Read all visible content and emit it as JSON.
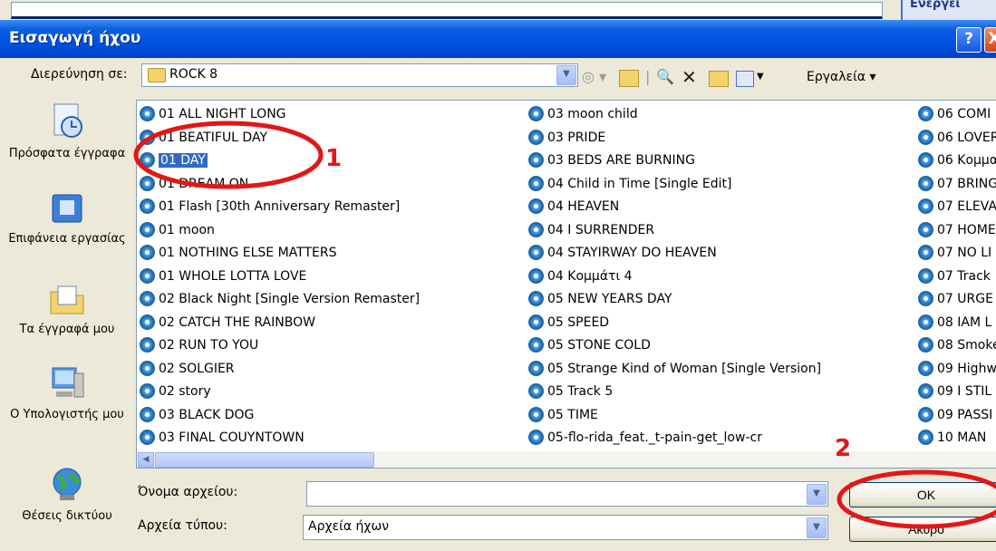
{
  "background": {
    "right_fragment_text": "Ενεργεί"
  },
  "dialog": {
    "title": "Εισαγωγή ήχου",
    "help_button": "?",
    "close_button": "X"
  },
  "look_in": {
    "label": "Διερεύνηση σε:",
    "value": "ROCK 8",
    "tools_label": "Εργαλεία ▾"
  },
  "places": [
    {
      "label": "Πρόσφατα έγγραφα",
      "icon": "recent-documents-icon"
    },
    {
      "label": "Επιφάνεια εργασίας",
      "icon": "desktop-icon"
    },
    {
      "label": "Τα έγγραφά μου",
      "icon": "my-documents-icon"
    },
    {
      "label": "Ο Υπολογιστής μου",
      "icon": "my-computer-icon"
    },
    {
      "label": "Θέσεις δικτύου",
      "icon": "network-places-icon"
    }
  ],
  "files": {
    "col1": [
      "01 ALL NIGHT LONG",
      "01 BEATIFUL DAY",
      "01 DAY",
      "01 DREAM ON",
      "01 Flash [30th Anniversary Remaster]",
      "01 moon",
      "01 NOTHING ELSE MATTERS",
      "01 WHOLE LOTTA LOVE",
      "02 Black Night [Single Version Remaster]",
      "02 CATCH THE RAINBOW",
      "02 RUN TO YOU",
      "02 SOLGIER",
      "02 story",
      "03 BLACK DOG",
      "03 FINAL COUYNTOWN"
    ],
    "col2": [
      "03 moon child",
      "03 PRIDE",
      "03 BEDS  ARE BURNING",
      "04 Child in Time [Single Edit]",
      "04 HEAVEN",
      "04 I SURRENDER",
      "04 STAYIRWAY DO HEAVEN",
      "04 Κομμάτι 4",
      "05 NEW YEARS DAY",
      "05 SPEED",
      "05 STONE COLD",
      "05 Strange Kind of Woman [Single Version]",
      "05 Track 5",
      "05 TIME",
      "05-flo-rida_feat._t-pain-get_low-cr"
    ],
    "col3": [
      "06 COMI",
      "06 LOVER",
      "06 Κομμα",
      "07 BRING",
      "07 ELEVA",
      "07 HOME",
      "07 NO LI",
      "07 Track",
      "07 URGE",
      "08 IAM L",
      "08 Smoke",
      "09 Highw",
      "09 I STIL",
      "09 PASSI",
      "10 MAN"
    ],
    "selected": "01 DAY"
  },
  "filename": {
    "label": "Όνομα αρχείου:",
    "value": ""
  },
  "filetype": {
    "label": "Αρχεία τύπου:",
    "value": "Αρχεία ήχων"
  },
  "buttons": {
    "ok": "OK",
    "cancel": "Άκυρο"
  },
  "annotations": {
    "marker1": "1",
    "marker2": "2",
    "color": "#e41616"
  }
}
